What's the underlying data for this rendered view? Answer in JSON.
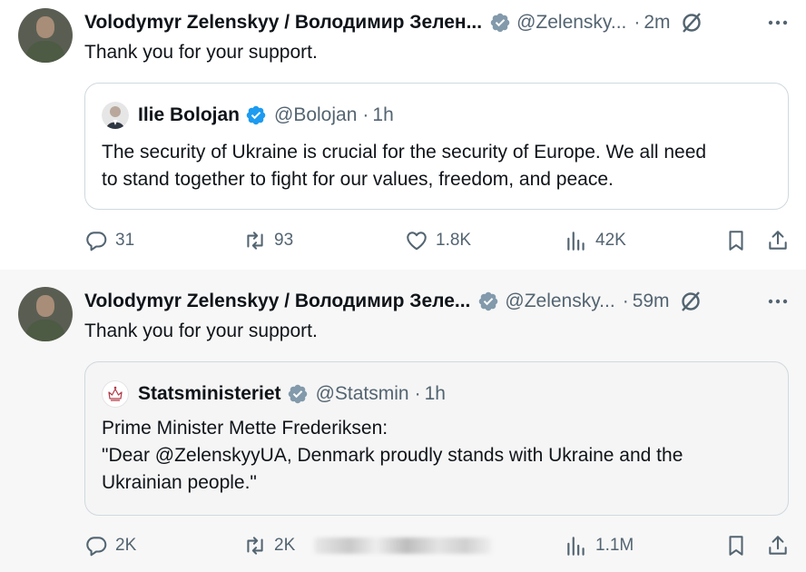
{
  "tweets": [
    {
      "author_name": "Volodymyr Zelenskyy / Володимир Зелен...",
      "handle": "@Zelensky...",
      "separator": "·",
      "time": "2m",
      "text": "Thank you for your support.",
      "quote": {
        "author_name": "Ilie Bolojan",
        "handle": "@Bolojan",
        "separator": "·",
        "time": "1h",
        "lines": [
          "The security of Ukraine is crucial for the security of Europe. We all need",
          "to stand together to fight for our values, freedom, and peace."
        ]
      },
      "stats": {
        "replies": "31",
        "reposts": "93",
        "likes": "1.8K",
        "views": "42K"
      }
    },
    {
      "author_name": "Volodymyr Zelenskyy / Володимир Зеле...",
      "handle": "@Zelensky...",
      "separator": "·",
      "time": "59m",
      "text": "Thank you for your support.",
      "quote": {
        "author_name": "Statsministeriet",
        "handle": "@Statsmin",
        "separator": "·",
        "time": "1h",
        "lines": [
          "Prime Minister Mette Frederiksen:",
          "\"Dear @ZelenskyyUA, Denmark proudly stands with Ukraine and the",
          "Ukrainian people.\""
        ]
      },
      "stats": {
        "replies": "2K",
        "reposts": "2K",
        "views": "1.1M"
      }
    }
  ],
  "colors": {
    "verified_gray": "#829aab",
    "verified_blue": "#1d9bf0",
    "secondary_text": "#536471",
    "second_tweet_bg": "#f7f7f7"
  },
  "icons": [
    "verified-badge-icon",
    "grok-icon",
    "more-icon",
    "reply-icon",
    "repost-icon",
    "like-icon",
    "views-icon",
    "bookmark-icon",
    "share-icon"
  ]
}
